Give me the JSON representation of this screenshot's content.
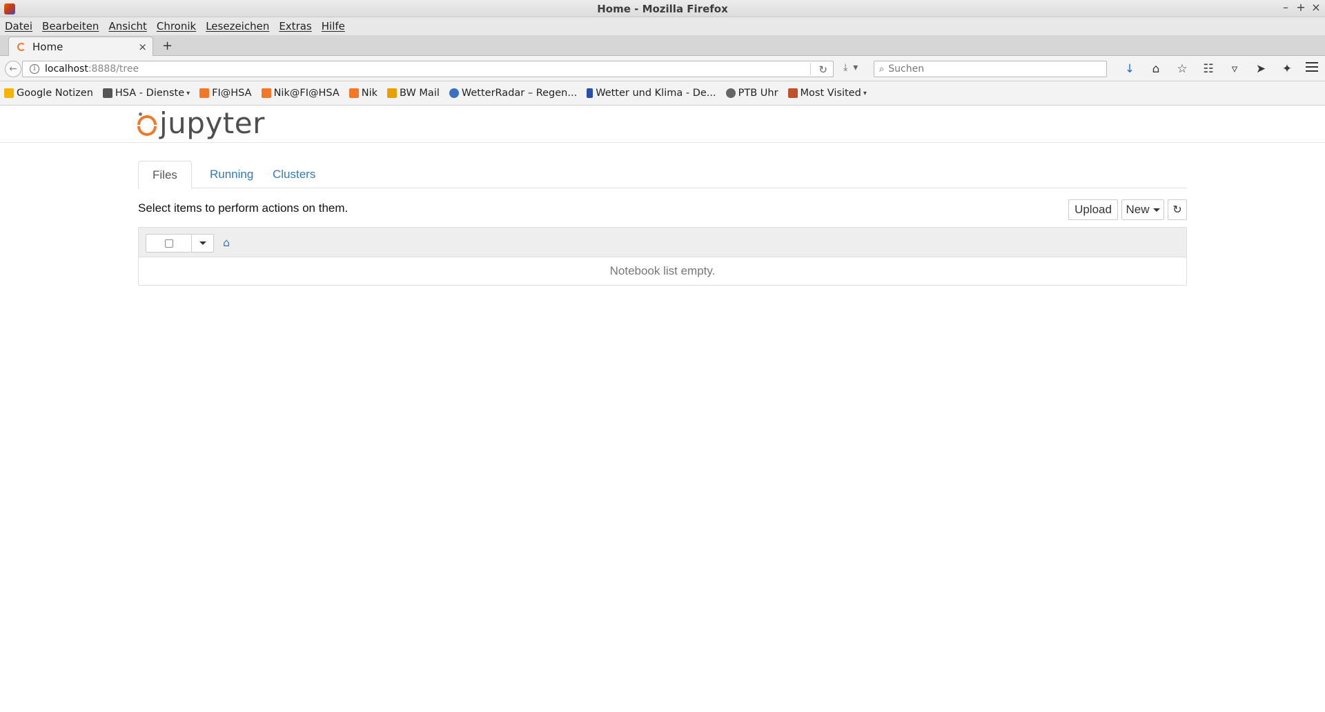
{
  "window": {
    "title": "Home - Mozilla Firefox",
    "controls": [
      "–",
      "+",
      "×"
    ]
  },
  "menubar": {
    "items": [
      "Datei",
      "Bearbeiten",
      "Ansicht",
      "Chronik",
      "Lesezeichen",
      "Extras",
      "Hilfe"
    ]
  },
  "tabs": {
    "active_label": "Home",
    "close": "×",
    "new_tab": "+"
  },
  "navbar": {
    "url_host": "localhost",
    "url_path": ":8888/tree",
    "search_placeholder": "Suchen"
  },
  "bookmarks": {
    "items": [
      {
        "label": "Google Notizen",
        "color": "#f4b400",
        "dropdown": false
      },
      {
        "label": "HSA - Dienste",
        "color": "#555555",
        "dropdown": true
      },
      {
        "label": "FI@HSA",
        "color": "#f37726",
        "dropdown": false
      },
      {
        "label": "Nik@FI@HSA",
        "color": "#f37726",
        "dropdown": false
      },
      {
        "label": "Nik",
        "color": "#f37726",
        "dropdown": false
      },
      {
        "label": "BW Mail",
        "color": "#e8a000",
        "dropdown": false
      },
      {
        "label": "WetterRadar – Regen...",
        "color": "#3a6fc4",
        "dropdown": false
      },
      {
        "label": "Wetter und Klima - De...",
        "color": "#2a4fa8",
        "dropdown": false
      },
      {
        "label": "PTB Uhr",
        "color": "#666666",
        "dropdown": false
      },
      {
        "label": "Most Visited",
        "color": "#c0522a",
        "dropdown": true
      }
    ]
  },
  "jupyter": {
    "logo_text": "jupyter",
    "tabs": [
      "Files",
      "Running",
      "Clusters"
    ],
    "hint": "Select items to perform actions on them.",
    "upload_label": "Upload",
    "new_label": "New",
    "empty_message": "Notebook list empty.",
    "accent_color": "#f37726",
    "link_color": "#337ab7"
  }
}
